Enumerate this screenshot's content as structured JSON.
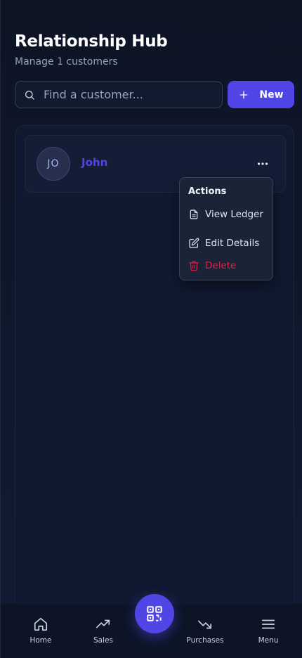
{
  "header": {
    "title": "Relationship Hub",
    "subtitle": "Manage 1 customers"
  },
  "search": {
    "placeholder": "Find a customer...",
    "value": "",
    "icon": "search-icon"
  },
  "new_button": {
    "label": "New",
    "icon": "plus-icon"
  },
  "customers": [
    {
      "initials": "JO",
      "name": "John"
    }
  ],
  "actions_menu": {
    "title": "Actions",
    "items": [
      {
        "label": "View Ledger",
        "icon": "document-icon"
      },
      {
        "label": "Edit Details",
        "icon": "edit-icon"
      },
      {
        "label": "Delete",
        "icon": "trash-icon"
      }
    ]
  },
  "bottom_nav": {
    "items": [
      {
        "label": "Home",
        "icon": "home-icon"
      },
      {
        "label": "Sales",
        "icon": "trending-up-icon"
      },
      {
        "label": "Purchases",
        "icon": "trending-down-icon"
      },
      {
        "label": "Menu",
        "icon": "hamburger-icon"
      }
    ],
    "fab_icon": "qr-code-icon"
  },
  "colors": {
    "accent": "#4f46e5",
    "danger": "#e11d48",
    "background": "#0f172a"
  }
}
